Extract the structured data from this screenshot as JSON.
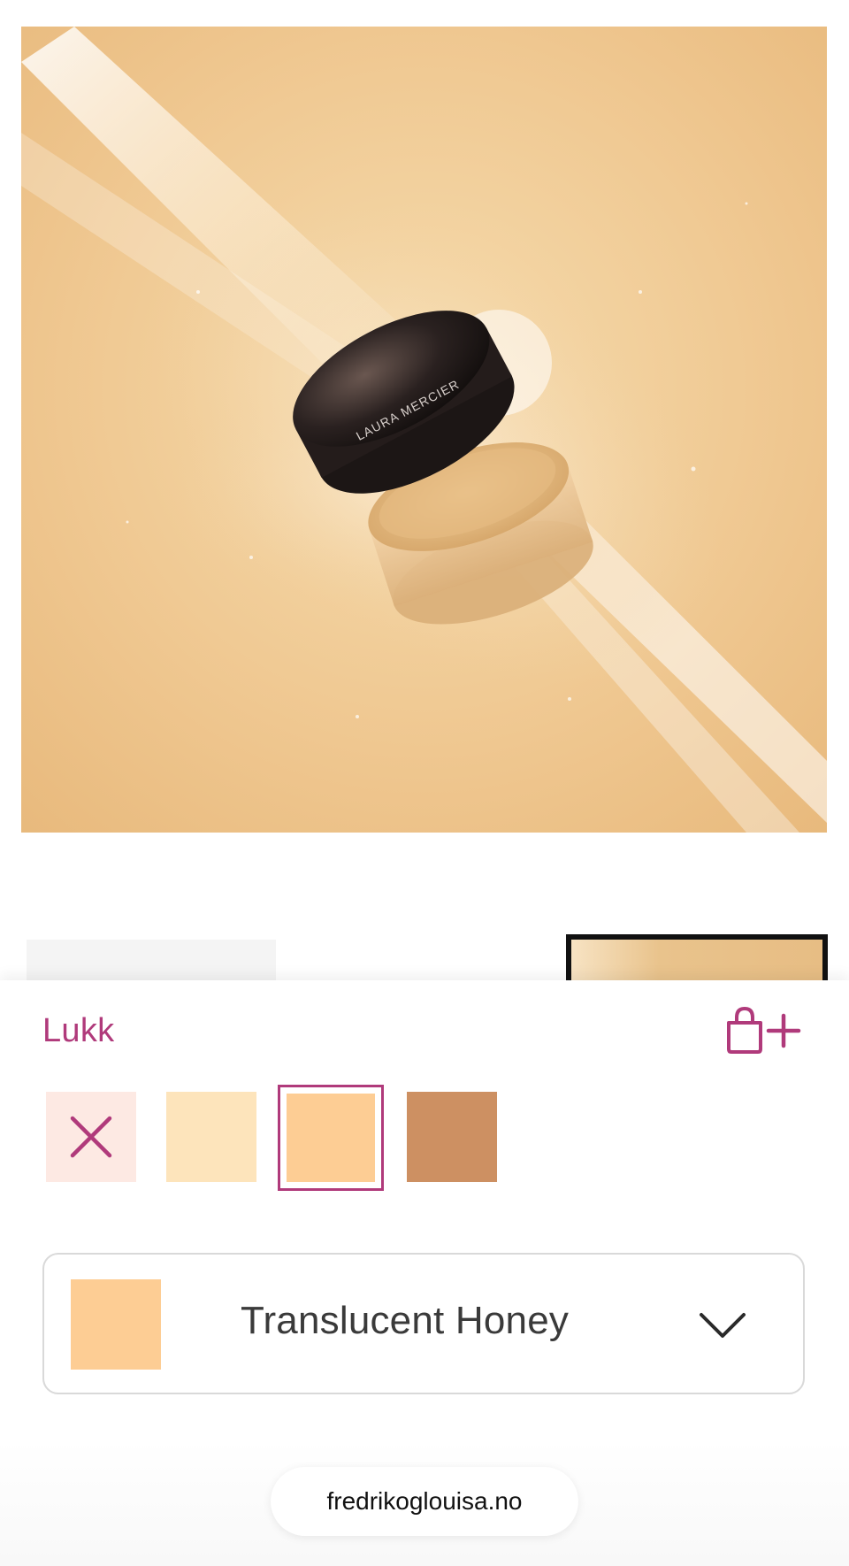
{
  "product_image": {
    "brand_text": "LAURA MERCIER"
  },
  "sheet": {
    "close_label": "Lukk",
    "add_to_bag_icon": "bag-plus-icon"
  },
  "swatches": [
    {
      "id": "none",
      "icon": "close-x-icon",
      "color": "#fde9e3",
      "accent": "#b03a7b"
    },
    {
      "id": "translucent",
      "color": "#fde4bb"
    },
    {
      "id": "translucent-honey",
      "color": "#fdcd94",
      "selected": true
    },
    {
      "id": "medium-deep",
      "color": "#cd9062"
    }
  ],
  "shade_select": {
    "selected_label": "Translucent Honey",
    "selected_color": "#fdcd94",
    "chevron_icon": "chevron-down-icon"
  },
  "browser": {
    "domain": "fredrikoglouisa.no"
  },
  "colors": {
    "accent": "#b03a7b",
    "border": "#d9d9d9"
  }
}
